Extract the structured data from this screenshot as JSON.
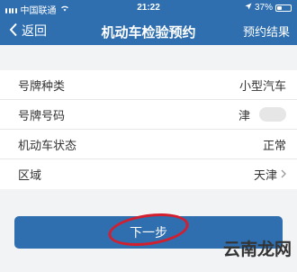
{
  "status_bar": {
    "carrier": "中国联通",
    "time": "21:22",
    "battery": "37%",
    "battery_level": 0.37
  },
  "nav": {
    "back_label": "返回",
    "title": "机动车检验预约",
    "right_label": "预约结果"
  },
  "fields": [
    {
      "label": "号牌种类",
      "value": "小型汽车"
    },
    {
      "label": "号牌号码",
      "value": "津"
    },
    {
      "label": "机动车状态",
      "value": "正常"
    },
    {
      "label": "区域",
      "value": "天津"
    }
  ],
  "button": {
    "next_label": "下一步"
  },
  "watermark": "云南龙网",
  "colors": {
    "primary": "#2f6fb0",
    "annotation": "#d21f2f"
  }
}
